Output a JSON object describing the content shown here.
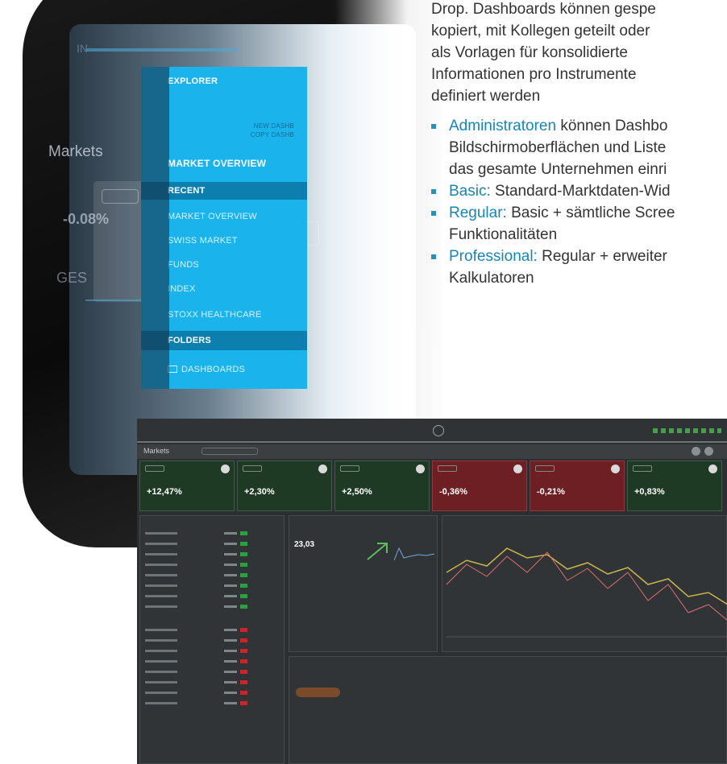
{
  "tablet": {
    "background_labels": {
      "tab": "IN",
      "markets": "Markets",
      "value": "-0.08%",
      "section": "GES"
    },
    "menu": {
      "explorer": "EXPLORER",
      "new_dashboard": "NEW DASHB",
      "copy_dashboard": "COPY DASHB",
      "market_overview_header": "MARKET OVERVIEW",
      "recent": "RECENT",
      "items": [
        "MARKET OVERVIEW",
        "SWISS MARKET",
        "FUNDS",
        "INDEX",
        "STOXX HEALTHCARE"
      ],
      "folders": "FOLDERS",
      "dashboards": "DASHBOARDS",
      "accent_color": "#1ab3eb",
      "selected_color": "#0c7fae"
    }
  },
  "text": {
    "intro_lines": [
      "Drop. Dashboards können gespe",
      "kopiert, mit Kollegen geteilt oder",
      "als Vorlagen für konsolidierte",
      "Informationen pro Instrumente",
      "definiert werden"
    ],
    "bullets": [
      {
        "label": "Administratoren",
        "lines": [
          " können Dashbo",
          "Bildschirmoberflächen und Liste",
          "das gesamte Unternehmen einri"
        ]
      },
      {
        "label": "Basic:",
        "lines": [
          " Standard-Marktdaten-Wid"
        ]
      },
      {
        "label": "Regular:",
        "lines": [
          " Basic + sämtliche Scree",
          "Funktionalitäten"
        ]
      },
      {
        "label": "Professional:",
        "lines": [
          " Regular + erweiter",
          "Kalkulatoren"
        ]
      }
    ],
    "label_color": "#1786b4"
  },
  "dashboard": {
    "title": "Markets",
    "cards": [
      {
        "value": "+12,47%",
        "status": "up"
      },
      {
        "value": "+2,30%",
        "status": "up"
      },
      {
        "value": "+2,50%",
        "status": "up"
      },
      {
        "value": "-0,36%",
        "status": "down"
      },
      {
        "value": "-0,21%",
        "status": "down"
      },
      {
        "value": "+0,83%",
        "status": "up"
      }
    ],
    "quote_value": "23,03",
    "up_color": "#2e9e43",
    "down_color": "#c8262b"
  }
}
